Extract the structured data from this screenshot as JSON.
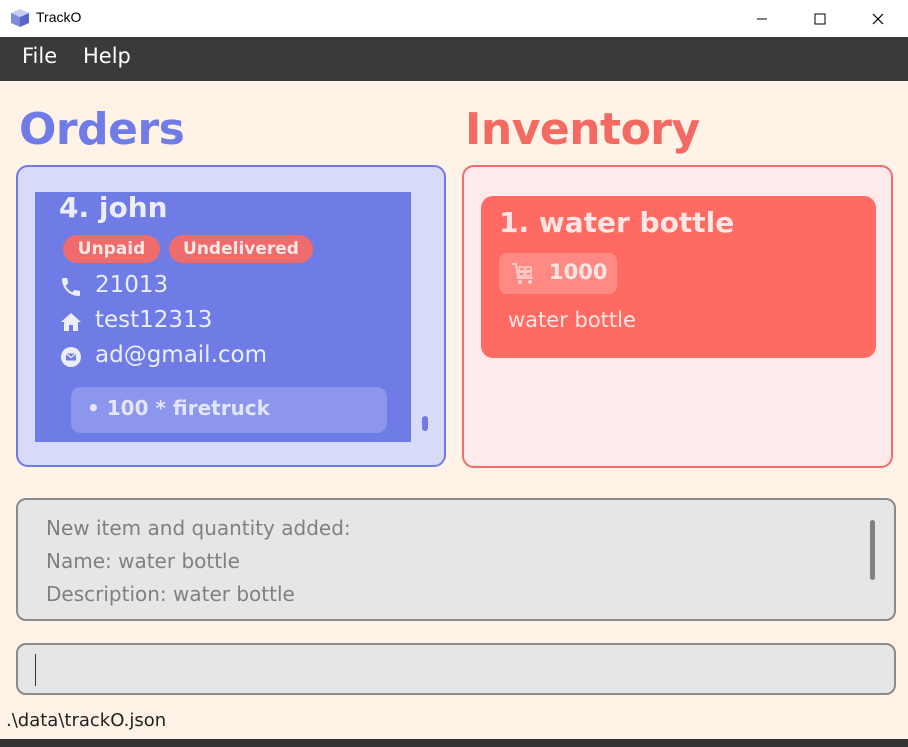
{
  "window": {
    "title": "TrackO",
    "minimize_icon": "minimize-icon",
    "maximize_icon": "maximize-icon",
    "close_icon": "close-icon"
  },
  "menu": {
    "items": [
      "File",
      "Help"
    ]
  },
  "orders": {
    "heading": "Orders",
    "heading_color": "#6f7ce6",
    "cards": [
      {
        "name": "4.  john",
        "tags": [
          "Unpaid",
          "Undelivered"
        ],
        "phone": "21013",
        "address": "test12313",
        "email": "ad@gmail.com",
        "items": [
          "• 100 * firetruck"
        ]
      }
    ]
  },
  "inventory": {
    "heading": "Inventory",
    "heading_color": "#f36a63",
    "cards": [
      {
        "name": "1.  water bottle",
        "quantity": "1000",
        "description": "water bottle"
      }
    ]
  },
  "result": {
    "lines": [
      "New item and quantity added:",
      "Name: water bottle",
      "Description: water bottle"
    ]
  },
  "command": {
    "value": ""
  },
  "status": {
    "path": ".\\data\\trackO.json"
  }
}
